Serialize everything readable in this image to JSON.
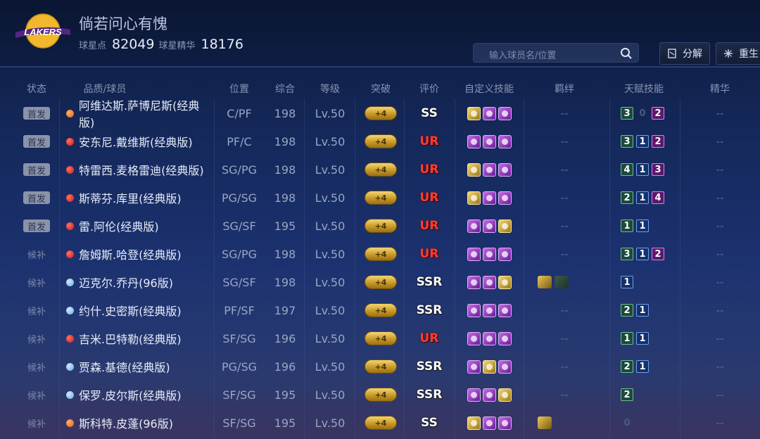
{
  "header": {
    "team_name": "LAKERS",
    "player_name": "倘若问心有愧",
    "stat1_label": "球星点",
    "stat1_value": "82049",
    "stat2_label": "球星精华",
    "stat2_value": "18176",
    "search_placeholder": "输入球员名/位置",
    "btn_decompose": "分解",
    "btn_rebirth": "重生"
  },
  "columns": [
    "状态",
    "品质/球员",
    "位置",
    "综合",
    "等级",
    "突破",
    "评价",
    "自定义技能",
    "羁绊",
    "天赋技能",
    "精华"
  ],
  "rows": [
    {
      "status": "首发",
      "status_type": "starter",
      "dot": "orange",
      "name": "阿维达斯.萨博尼斯(经典版)",
      "pos": "C/PF",
      "ovr": "198",
      "lv": "Lv.50",
      "bt": "+4",
      "rating": "SS",
      "rating_type": "ss",
      "skills": [
        "gold",
        "purple",
        "purple"
      ],
      "bonds": [],
      "bond_text": "--",
      "talent": [
        {
          "v": "3",
          "c": "green"
        },
        {
          "v": "0",
          "c": "empty"
        },
        {
          "v": "2",
          "c": "magenta"
        }
      ],
      "essence": "--"
    },
    {
      "status": "首发",
      "status_type": "starter",
      "dot": "red",
      "name": "安东尼.戴维斯(经典版)",
      "pos": "PF/C",
      "ovr": "198",
      "lv": "Lv.50",
      "bt": "+4",
      "rating": "UR",
      "rating_type": "ur",
      "skills": [
        "purple",
        "purple",
        "purple"
      ],
      "bonds": [],
      "bond_text": "--",
      "talent": [
        {
          "v": "3",
          "c": "green"
        },
        {
          "v": "1",
          "c": "blue"
        },
        {
          "v": "2",
          "c": "magenta"
        }
      ],
      "essence": "--"
    },
    {
      "status": "首发",
      "status_type": "starter",
      "dot": "red",
      "name": "特雷西.麦格雷迪(经典版)",
      "pos": "SG/PG",
      "ovr": "198",
      "lv": "Lv.50",
      "bt": "+4",
      "rating": "UR",
      "rating_type": "ur",
      "skills": [
        "gold",
        "purple",
        "purple"
      ],
      "bonds": [],
      "bond_text": "--",
      "talent": [
        {
          "v": "4",
          "c": "green"
        },
        {
          "v": "1",
          "c": "blue"
        },
        {
          "v": "3",
          "c": "magenta"
        }
      ],
      "essence": "--"
    },
    {
      "status": "首发",
      "status_type": "starter",
      "dot": "red",
      "name": "斯蒂芬.库里(经典版)",
      "pos": "PG/SG",
      "ovr": "198",
      "lv": "Lv.50",
      "bt": "+4",
      "rating": "UR",
      "rating_type": "ur",
      "skills": [
        "gold",
        "purple",
        "purple"
      ],
      "bonds": [],
      "bond_text": "--",
      "talent": [
        {
          "v": "2",
          "c": "green"
        },
        {
          "v": "1",
          "c": "blue"
        },
        {
          "v": "4",
          "c": "magenta"
        }
      ],
      "essence": "--"
    },
    {
      "status": "首发",
      "status_type": "starter",
      "dot": "red",
      "name": "雷.阿伦(经典版)",
      "pos": "SG/SF",
      "ovr": "195",
      "lv": "Lv.50",
      "bt": "+4",
      "rating": "UR",
      "rating_type": "ur",
      "skills": [
        "purple",
        "purple",
        "gold"
      ],
      "bonds": [],
      "bond_text": "--",
      "talent": [
        {
          "v": "1",
          "c": "green"
        },
        {
          "v": "1",
          "c": "blue"
        }
      ],
      "essence": "--"
    },
    {
      "status": "候补",
      "status_type": "bench",
      "dot": "red",
      "name": "詹姆斯.哈登(经典版)",
      "pos": "SG/PG",
      "ovr": "198",
      "lv": "Lv.50",
      "bt": "+4",
      "rating": "UR",
      "rating_type": "ur",
      "skills": [
        "purple",
        "purple",
        "purple"
      ],
      "bonds": [],
      "bond_text": "--",
      "talent": [
        {
          "v": "3",
          "c": "green"
        },
        {
          "v": "1",
          "c": "blue"
        },
        {
          "v": "2",
          "c": "magenta"
        }
      ],
      "essence": "--"
    },
    {
      "status": "候补",
      "status_type": "bench",
      "dot": "blue",
      "name": "迈克尔.乔丹(96版)",
      "pos": "SG/SF",
      "ovr": "198",
      "lv": "Lv.50",
      "bt": "+4",
      "rating": "SSR",
      "rating_type": "ssr",
      "skills": [
        "purple",
        "purple",
        "gold"
      ],
      "bonds": [
        "gold",
        "dim"
      ],
      "bond_text": "",
      "talent": [
        {
          "v": "1",
          "c": "blue"
        }
      ],
      "essence": "--"
    },
    {
      "status": "候补",
      "status_type": "bench",
      "dot": "blue",
      "name": "约什.史密斯(经典版)",
      "pos": "PF/SF",
      "ovr": "197",
      "lv": "Lv.50",
      "bt": "+4",
      "rating": "SSR",
      "rating_type": "ssr",
      "skills": [
        "purple",
        "purple",
        "purple"
      ],
      "bonds": [],
      "bond_text": "--",
      "talent": [
        {
          "v": "2",
          "c": "green"
        },
        {
          "v": "1",
          "c": "blue"
        }
      ],
      "essence": "--"
    },
    {
      "status": "候补",
      "status_type": "bench",
      "dot": "red",
      "name": "吉米.巴特勒(经典版)",
      "pos": "SF/SG",
      "ovr": "196",
      "lv": "Lv.50",
      "bt": "+4",
      "rating": "UR",
      "rating_type": "ur",
      "skills": [
        "purple",
        "purple",
        "purple"
      ],
      "bonds": [],
      "bond_text": "--",
      "talent": [
        {
          "v": "1",
          "c": "green"
        },
        {
          "v": "1",
          "c": "blue"
        }
      ],
      "essence": "--"
    },
    {
      "status": "候补",
      "status_type": "bench",
      "dot": "blue",
      "name": "贾森.基德(经典版)",
      "pos": "PG/SG",
      "ovr": "196",
      "lv": "Lv.50",
      "bt": "+4",
      "rating": "SSR",
      "rating_type": "ssr",
      "skills": [
        "purple",
        "gold",
        "purple"
      ],
      "bonds": [],
      "bond_text": "--",
      "talent": [
        {
          "v": "2",
          "c": "green"
        },
        {
          "v": "1",
          "c": "blue"
        }
      ],
      "essence": "--"
    },
    {
      "status": "候补",
      "status_type": "bench",
      "dot": "blue",
      "name": "保罗.皮尔斯(经典版)",
      "pos": "SF/SG",
      "ovr": "195",
      "lv": "Lv.50",
      "bt": "+4",
      "rating": "SSR",
      "rating_type": "ssr",
      "skills": [
        "purple",
        "purple",
        "gold"
      ],
      "bonds": [],
      "bond_text": "--",
      "talent": [
        {
          "v": "2",
          "c": "green"
        }
      ],
      "essence": "--"
    },
    {
      "status": "候补",
      "status_type": "bench",
      "dot": "orange",
      "name": "斯科特.皮蓬(96版)",
      "pos": "SF/SG",
      "ovr": "195",
      "lv": "Lv.50",
      "bt": "+4",
      "rating": "SS",
      "rating_type": "ss",
      "skills": [
        "gold",
        "purple",
        "purple"
      ],
      "bonds": [
        "gold"
      ],
      "bond_text": "",
      "talent": [
        {
          "v": "0",
          "c": "empty"
        }
      ],
      "essence": "--"
    }
  ]
}
